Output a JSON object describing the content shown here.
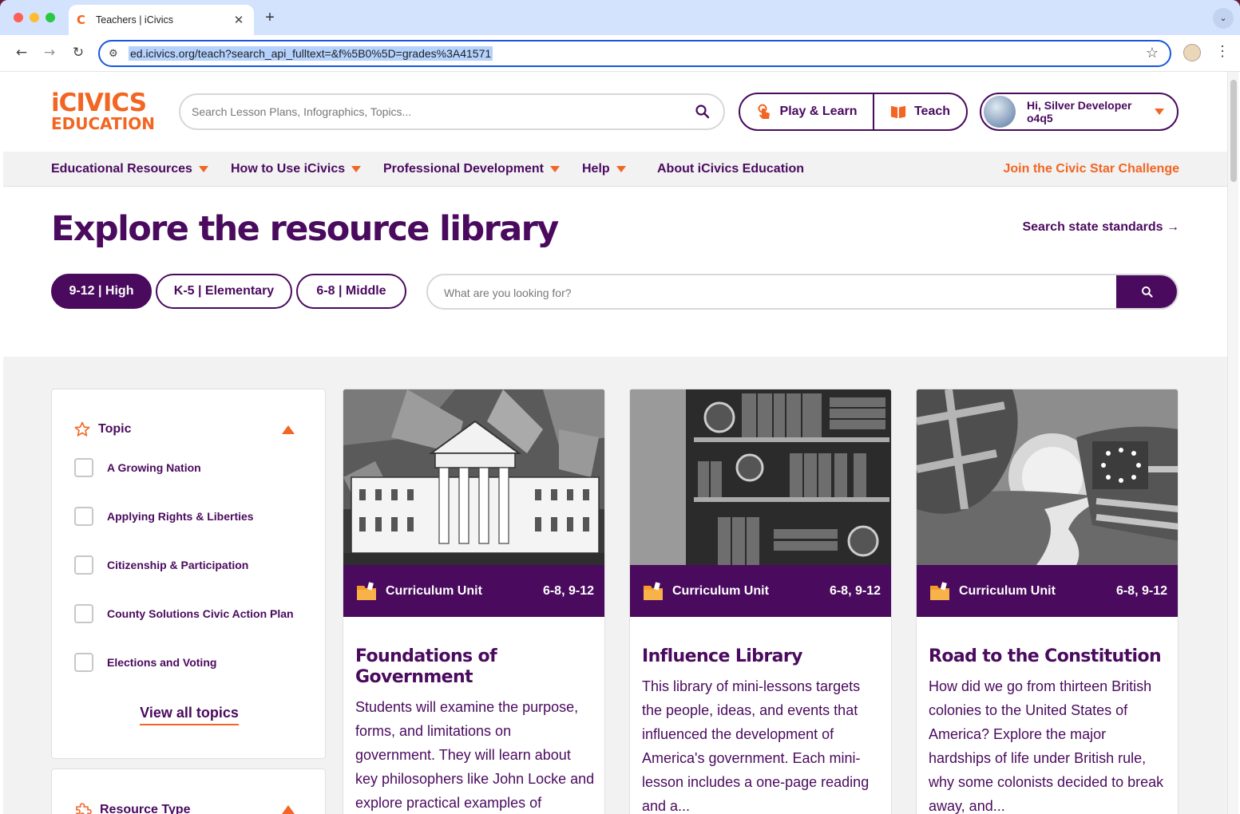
{
  "browser": {
    "tab_title": "Teachers | iCivics",
    "favicon": "C",
    "url": "ed.icivics.org/teach?search_api_fulltext=&f%5B0%5D=grades%3A41571"
  },
  "header": {
    "logo_line1": "iCIVICS",
    "logo_line2": "EDUCATION",
    "search_placeholder": "Search Lesson Plans, Infographics, Topics...",
    "play_label": "Play & Learn",
    "teach_label": "Teach",
    "user_greeting": "Hi, Silver Developer o4q5"
  },
  "nav": {
    "items": [
      {
        "label": "Educational Resources"
      },
      {
        "label": "How to Use iCivics"
      },
      {
        "label": "Professional Development"
      },
      {
        "label": "Help"
      },
      {
        "label": "About iCivics Education"
      }
    ],
    "cta": "Join the Civic Star Challenge"
  },
  "hero": {
    "title": "Explore the resource library",
    "state_link": "Search state standards →",
    "grades": [
      {
        "label": "9-12 | High",
        "active": true
      },
      {
        "label": "K-5 | Elementary",
        "active": false
      },
      {
        "label": "6-8 | Middle",
        "active": false
      }
    ],
    "search_placeholder": "What are you looking for?"
  },
  "filters": {
    "topic_heading": "Topic",
    "topics": [
      "A Growing Nation",
      "Applying Rights & Liberties",
      "Citizenship & Participation",
      "County Solutions Civic Action Plan",
      "Elections and Voting"
    ],
    "view_all": "View all topics",
    "resource_type_heading": "Resource Type"
  },
  "cards": [
    {
      "type": "Curriculum Unit",
      "grades": "6-8, 9-12",
      "title": "Foundations of Government",
      "description": "Students will examine the purpose, forms, and limitations on government. They will learn about key philosophers like John Locke and explore practical examples of"
    },
    {
      "type": "Curriculum Unit",
      "grades": "6-8, 9-12",
      "title": "Influence Library",
      "description": "This library of mini-lessons targets the people, ideas, and events that influenced the development of America's government. Each mini-lesson includes a one-page reading and a..."
    },
    {
      "type": "Curriculum Unit",
      "grades": "6-8, 9-12",
      "title": "Road to the Constitution",
      "description": "How did we go from thirteen British colonies to the United States of America? Explore the major hardships of life under British rule, why some colonists decided to break away, and..."
    }
  ],
  "colors": {
    "brand_purple": "#4a0a5e",
    "brand_orange": "#f26522"
  },
  "icons": {
    "topic": "star-outline-icon",
    "resource_type": "puzzle-icon",
    "card_type": "folder-icon"
  }
}
